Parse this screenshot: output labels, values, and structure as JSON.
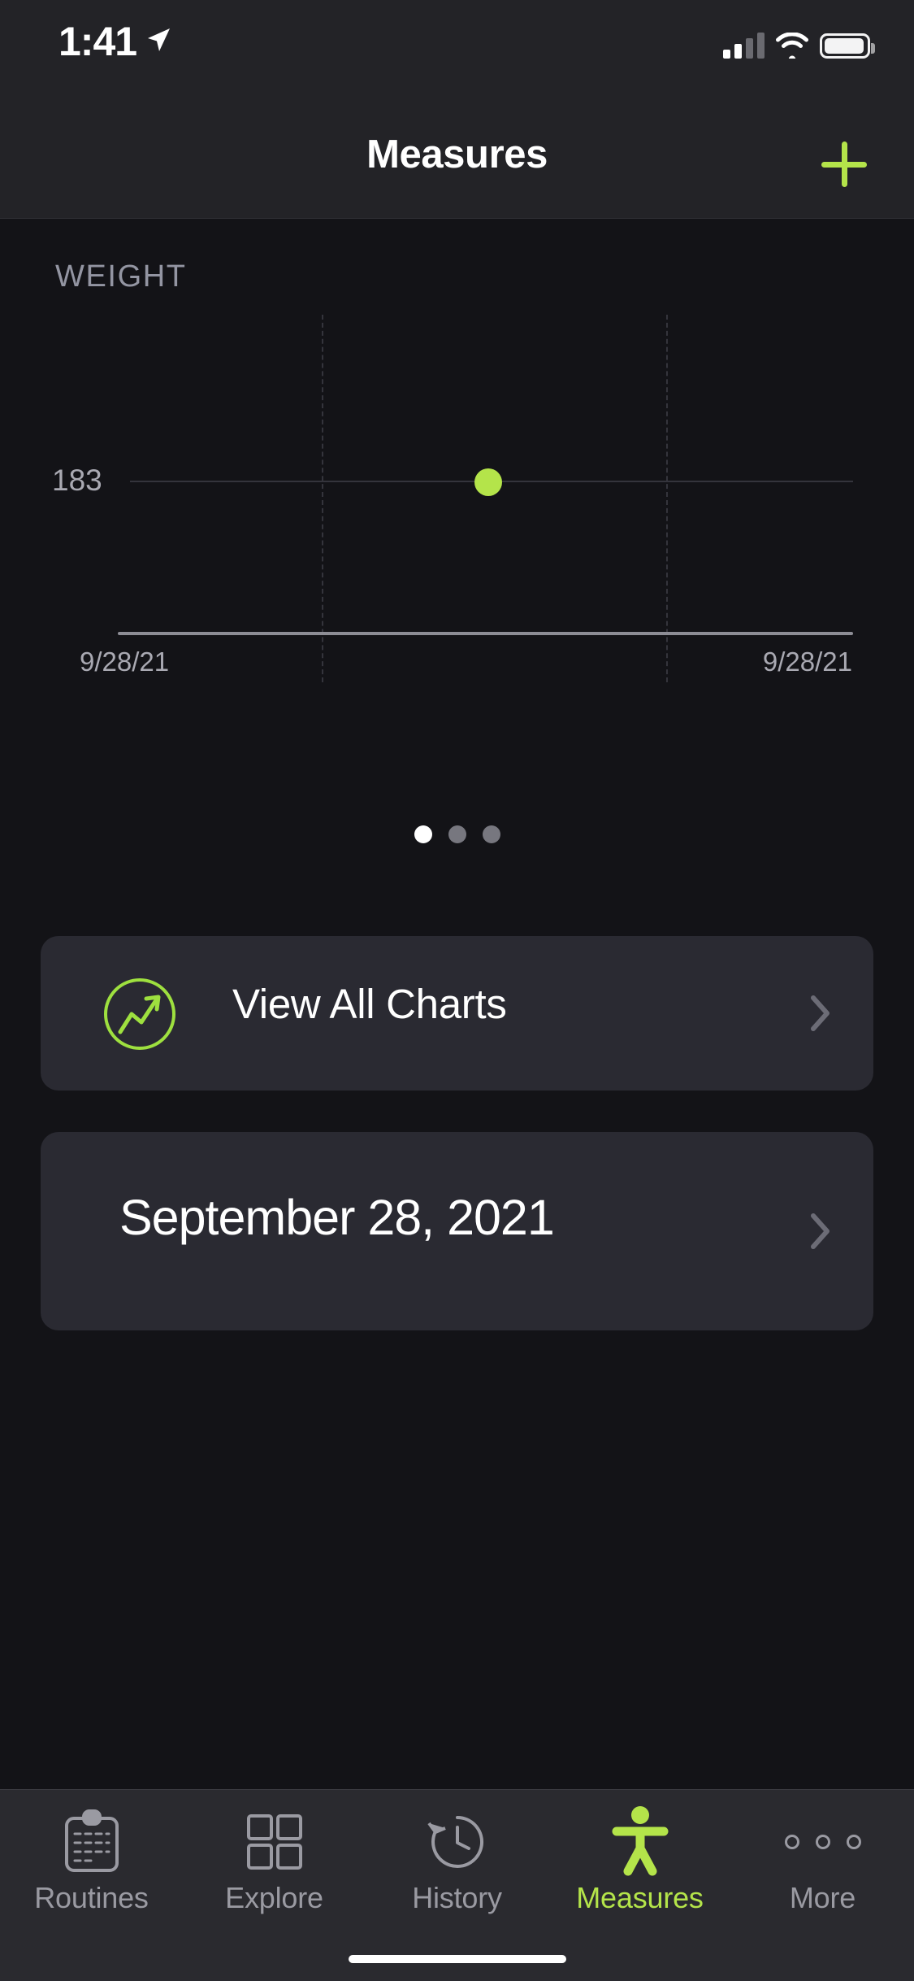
{
  "status_bar": {
    "time": "1:41",
    "location_icon": "location-arrow-icon",
    "cellular_icon": "cellular-signal-icon",
    "cellular_bars_filled": 2,
    "cellular_bars_total": 4,
    "wifi_icon": "wifi-icon",
    "battery_icon": "battery-icon"
  },
  "nav": {
    "title": "Measures",
    "add_icon": "plus-icon",
    "accent_color": "#b4e44a"
  },
  "chart_data": {
    "type": "scatter",
    "title": "WEIGHT",
    "series": [
      {
        "name": "Weight",
        "x": [
          "9/28/21"
        ],
        "values": [
          183
        ],
        "color": "#b4e44a"
      }
    ],
    "categories": [
      "9/28/21"
    ],
    "x_tick_labels": [
      "9/28/21",
      "9/28/21"
    ],
    "y_tick_labels": [
      "183"
    ],
    "ylim": [
      183,
      183
    ],
    "xlabel": "",
    "ylabel": "",
    "grid": "dashed-vertical",
    "legend": "none",
    "point_label": "183"
  },
  "pager": {
    "total": 3,
    "active_index": 0
  },
  "cards": [
    {
      "id": "view-all-charts",
      "label": "View All Charts",
      "icon": "trending-up-chart-icon",
      "chevron": "chevron-right-icon"
    },
    {
      "id": "entry-date",
      "label": "September 28, 2021",
      "chevron": "chevron-right-icon"
    }
  ],
  "tabbar": {
    "items": [
      {
        "label": "Routines",
        "icon": "clipboard-icon",
        "active": false
      },
      {
        "label": "Explore",
        "icon": "grid-squares-icon",
        "active": false
      },
      {
        "label": "History",
        "icon": "clock-rewind-icon",
        "active": false
      },
      {
        "label": "Measures",
        "icon": "body-figure-icon",
        "active": true
      },
      {
        "label": "More",
        "icon": "three-dots-icon",
        "active": false
      }
    ],
    "active_color": "#b4e44a",
    "inactive_color": "#9a9aa2"
  }
}
